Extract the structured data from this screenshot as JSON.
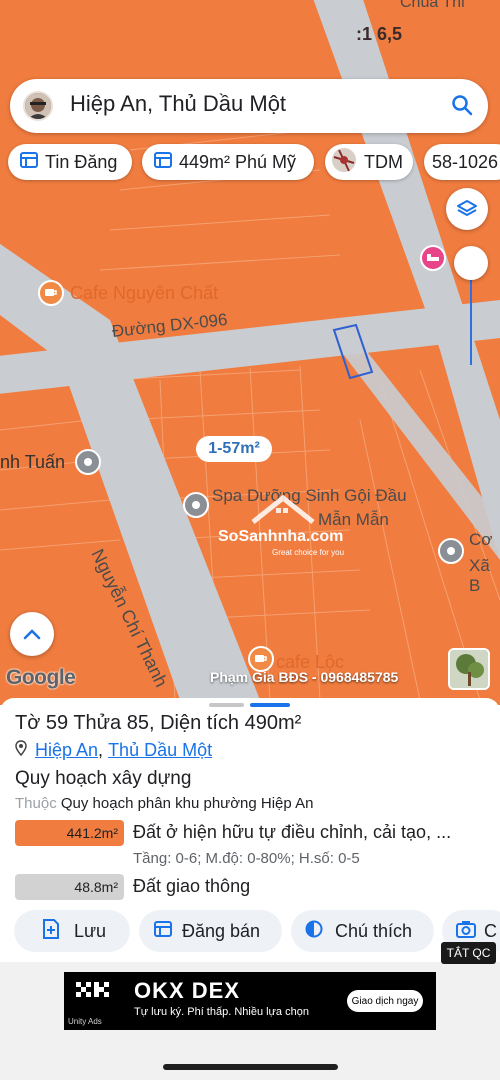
{
  "search": {
    "text": "Hiệp An, Thủ Dầu Một",
    "icon": "search-icon"
  },
  "chips": [
    {
      "label": "Tin Đăng",
      "icon": "listing-icon"
    },
    {
      "label": "449m² Phú Mỹ",
      "icon": "listing-icon"
    },
    {
      "label": "TDM",
      "icon": "map-thumbnail-icon"
    },
    {
      "label": "58-1026"
    }
  ],
  "map": {
    "top_place": "Chùa Thi",
    "top_code": ":1 6,5",
    "poi_cafe1": "Cafe Nguyên Chất",
    "street_dx": "Đường DX-096",
    "area_tag": "1-57m²",
    "poi_tuan": "nh Tuấn",
    "street_nct": "Nguyễn Chí Thanh",
    "poi_spa_line1": "Spa Dưỡng Sinh Gội Đầu",
    "poi_spa_line2": "Mẫn Mẫn",
    "poi_co_line1": "Cơ",
    "poi_co_line2": "Xã B",
    "poi_cafe2": "cafe Lộc",
    "watermark_brand": "SoSanhnha.com",
    "watermark_tagline": "Great choice for you",
    "google_logo": "Google",
    "broker": "Phạm Gia BĐS - 0968485785"
  },
  "parcel": {
    "title": "Tờ 59 Thửa 85, Diện tích 490m²",
    "ward": "Hiệp An",
    "separator": ",",
    "city": "Thủ Dầu Một",
    "section_title": "Quy hoạch xây dựng",
    "belongs_prefix": "Thuộc",
    "belongs_value": "Quy hoạch phân khu phường Hiệp An",
    "zones": [
      {
        "area": "441.2m²",
        "name": "Đất ở hiện hữu tự điều chỉnh, cải tạo, ...",
        "detail": "Tầng: 0-6; M.độ: 0-80%; H.số: 0-5",
        "color": "#f07c3f"
      },
      {
        "area": "48.8m²",
        "name": "Đất giao thông",
        "color": "#d2d2d2"
      }
    ]
  },
  "actions": [
    {
      "label": "Lưu",
      "icon": "save-plus-icon"
    },
    {
      "label": "Đăng bán",
      "icon": "listing-icon"
    },
    {
      "label": "Chú thích",
      "icon": "legend-icon"
    },
    {
      "label": "C",
      "icon": "camera-icon"
    }
  ],
  "ad": {
    "close_label": "TẮT QC",
    "brand": "OKX DEX",
    "tagline": "Tự lưu ký. Phí thấp. Nhiều lựa chọn",
    "cta": "Giao dịch ngay",
    "network": "Unity Ads"
  },
  "colors": {
    "map_orange": "#f07c3f",
    "road": "#c9cdd2",
    "link_blue": "#1a73e8",
    "parcel_blue": "#2f5fd0"
  }
}
